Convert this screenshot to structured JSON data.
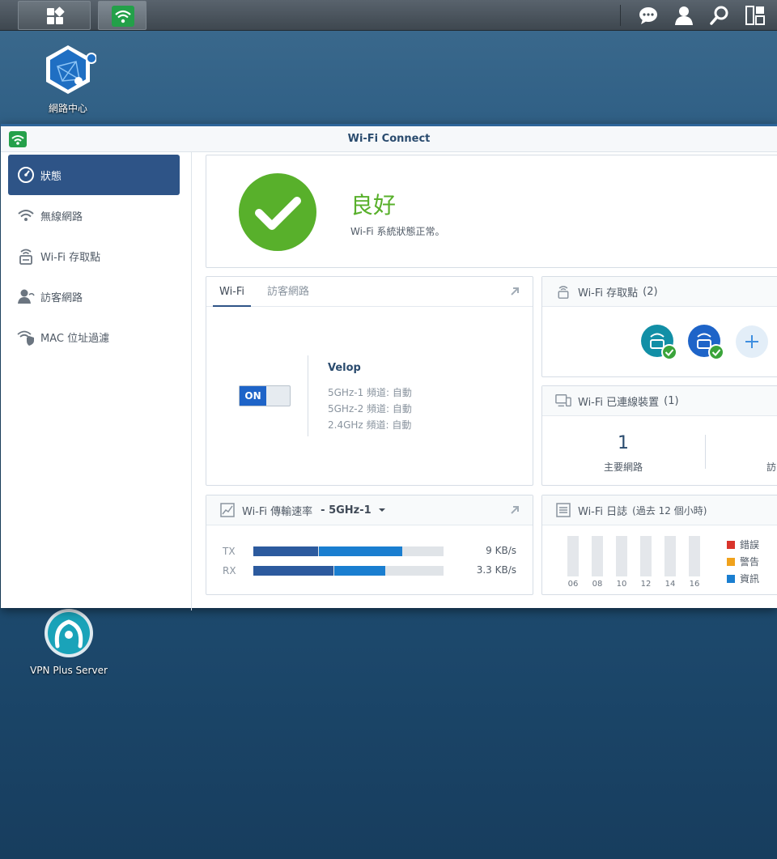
{
  "window": {
    "title": "Wi-Fi Connect"
  },
  "desktop": {
    "network_center_label": "網路中心",
    "vpn_label": "VPN Plus Server"
  },
  "sidebar": {
    "items": [
      {
        "label": "狀態",
        "icon": "dashboard-icon"
      },
      {
        "label": "無線網路",
        "icon": "wifi-icon"
      },
      {
        "label": "Wi-Fi 存取點",
        "icon": "access-point-icon"
      },
      {
        "label": "訪客網路",
        "icon": "guest-icon"
      },
      {
        "label": "MAC 位址過濾",
        "icon": "shield-wifi-icon"
      }
    ]
  },
  "status": {
    "title": "良好",
    "desc": "Wi-Fi 系統狀態正常。"
  },
  "wifi_card": {
    "tabs": [
      "Wi-Fi",
      "訪客網路"
    ],
    "toggle": "ON",
    "network_name": "Velop",
    "bands": [
      "5GHz-1 頻道: 自動",
      "5GHz-2 頻道: 自動",
      "2.4GHz 頻道: 自動"
    ]
  },
  "ap_card": {
    "title": "Wi-Fi 存取點",
    "count": "(2)"
  },
  "devices_card": {
    "title": "Wi-Fi 已連線裝置",
    "count": "(1)",
    "main_count": "1",
    "main_label": "主要網路",
    "guest_label_partial": "訪"
  },
  "rate_card": {
    "title": "Wi-Fi 傳輸速率",
    "band": "- 5GHz-1",
    "tx_label": "TX",
    "tx_value": "9 KB/s",
    "tx_fill": [
      0.34,
      0.78
    ],
    "rx_label": "RX",
    "rx_value": "3.3 KB/s",
    "rx_fill": [
      0.42,
      0.69
    ]
  },
  "log_card": {
    "title": "Wi-Fi 日誌",
    "range": "(過去 12 個小時)",
    "hours": [
      "06",
      "08",
      "10",
      "12",
      "14",
      "16"
    ],
    "legend": [
      {
        "label": "錯誤",
        "color": "#d9342b"
      },
      {
        "label": "警告",
        "color": "#f0a21c"
      },
      {
        "label": "資訊",
        "color": "#1a7ed0"
      }
    ]
  }
}
